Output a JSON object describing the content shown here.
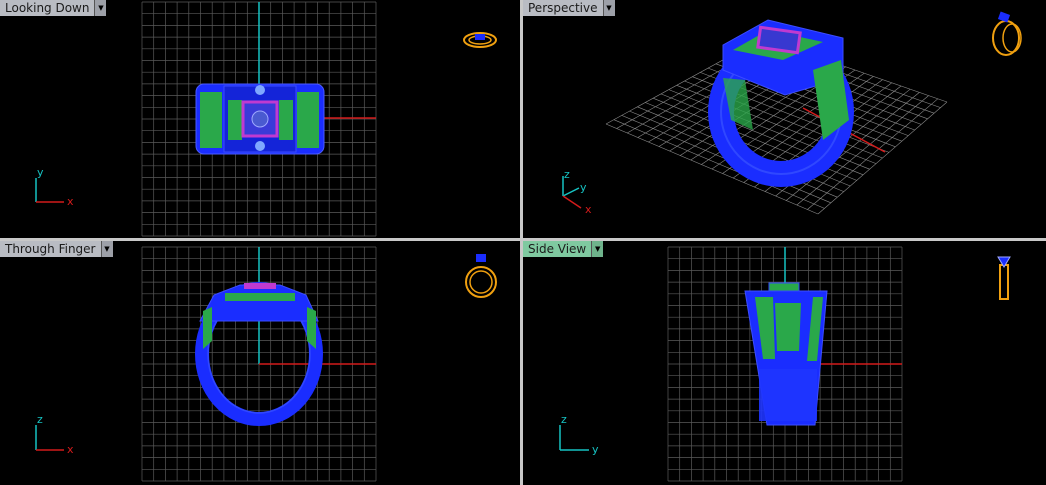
{
  "viewports": [
    {
      "id": "top",
      "label": "Looking Down",
      "active": false
    },
    {
      "id": "persp",
      "label": "Perspective",
      "active": false
    },
    {
      "id": "front",
      "label": "Through Finger",
      "active": false
    },
    {
      "id": "side",
      "label": "Side View",
      "active": true
    }
  ],
  "axes": {
    "top": {
      "v": "y",
      "h": "x"
    },
    "persp": {
      "z": "z",
      "y": "y",
      "x": "x"
    },
    "front": {
      "v": "z",
      "h": "x"
    },
    "side": {
      "v": "z",
      "h": "y"
    }
  },
  "colors": {
    "grid": "#5a5a5a",
    "mesh_blue": "#1a2dff",
    "mesh_green": "#2aa84a",
    "stone_pink": "#c03ad0",
    "axis_cyan": "#16c3c3",
    "axis_red": "#d31b1b",
    "gizmo_orange": "#f0a010",
    "active_tab": "#7fc9a0"
  },
  "icons": {
    "arrow": "chevron-down-icon",
    "gizmo": "ring-orientation-icon"
  }
}
